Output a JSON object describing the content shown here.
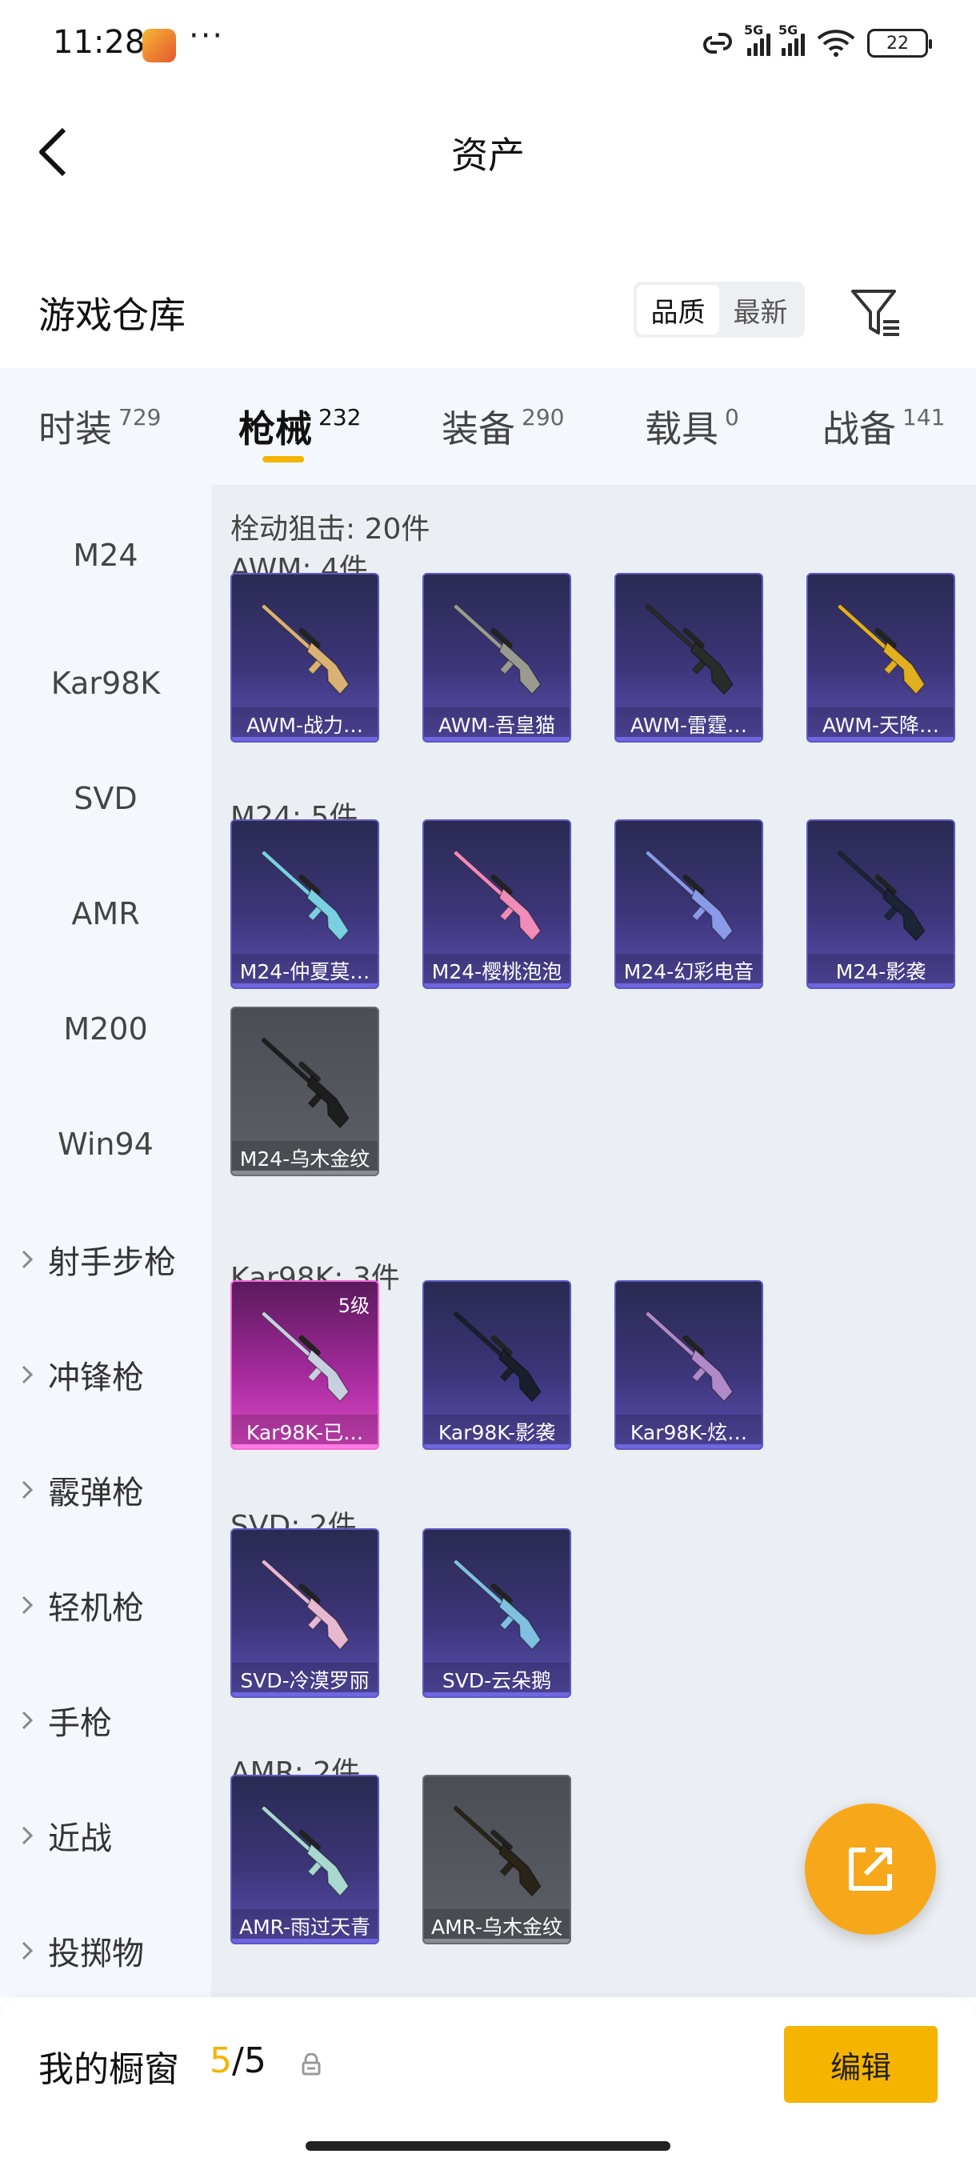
{
  "status_bar": {
    "time": "11:28",
    "more": "···",
    "net1": "5G",
    "net2": "5G",
    "battery": "22"
  },
  "header": {
    "title": "资产"
  },
  "warehouse": {
    "title": "游戏仓库",
    "sort_options": [
      "品质",
      "最新"
    ],
    "active_sort": "品质"
  },
  "category_tabs": [
    {
      "label": "时装",
      "count": "729"
    },
    {
      "label": "枪械",
      "count": "232",
      "active": true
    },
    {
      "label": "装备",
      "count": "290"
    },
    {
      "label": "载具",
      "count": "0"
    },
    {
      "label": "战备",
      "count": "141"
    }
  ],
  "side_nav": {
    "items": [
      "M24",
      "Kar98K",
      "SVD",
      "AMR",
      "M200",
      "Win94"
    ],
    "groups": [
      "射手步枪",
      "冲锋枪",
      "霰弹枪",
      "轻机枪",
      "手枪",
      "近战",
      "投掷物"
    ]
  },
  "content": {
    "category_header": "栓动狙击: 20件",
    "sections": [
      {
        "title": "AWM: 4件",
        "items": [
          {
            "name": "AWM-战力…",
            "style": "purple",
            "gun_color": "#d9b274"
          },
          {
            "name": "AWM-吾皇猫",
            "style": "purple",
            "gun_color": "#9a9a90"
          },
          {
            "name": "AWM-雷霆…",
            "style": "purple",
            "gun_color": "#2a2c2a"
          },
          {
            "name": "AWM-天降…",
            "style": "purple",
            "gun_color": "#e0b020"
          }
        ]
      },
      {
        "title": "M24: 5件",
        "items": [
          {
            "name": "M24-仲夏莫…",
            "style": "purple",
            "gun_color": "#7ad0e0"
          },
          {
            "name": "M24-樱桃泡泡",
            "style": "purple",
            "gun_color": "#f08cb8"
          },
          {
            "name": "M24-幻彩电音",
            "style": "purple",
            "gun_color": "#8a9ae8"
          },
          {
            "name": "M24-影袭",
            "style": "purple",
            "gun_color": "#1c2436"
          },
          {
            "name": "M24-乌木金纹",
            "style": "grey",
            "gun_color": "#1e1e1e"
          }
        ]
      },
      {
        "title": "Kar98K: 3件",
        "items": [
          {
            "name": "Kar98K-已…",
            "style": "pink",
            "gun_color": "#c8d0e0",
            "level": "5级"
          },
          {
            "name": "Kar98K-影袭",
            "style": "purple",
            "gun_color": "#1a1f2c"
          },
          {
            "name": "Kar98K-炫…",
            "style": "purple",
            "gun_color": "#b08ac8"
          }
        ]
      },
      {
        "title": "SVD: 2件",
        "items": [
          {
            "name": "SVD-冷漠罗丽",
            "style": "purple",
            "gun_color": "#e8b8d0"
          },
          {
            "name": "SVD-云朵鹅",
            "style": "purple",
            "gun_color": "#80c0e0"
          }
        ]
      },
      {
        "title": "AMR: 2件",
        "items": [
          {
            "name": "AMR-雨过天青",
            "style": "purple",
            "gun_color": "#a8d8d0"
          },
          {
            "name": "AMR-乌木金纹",
            "style": "grey",
            "gun_color": "#2a2418"
          }
        ]
      }
    ]
  },
  "bottom_bar": {
    "showcase_label": "我的橱窗",
    "showcase_current": "5",
    "showcase_total": "/5",
    "edit_label": "编辑"
  },
  "colors": {
    "accent": "#f5b400",
    "fab": "#f7a81a"
  }
}
